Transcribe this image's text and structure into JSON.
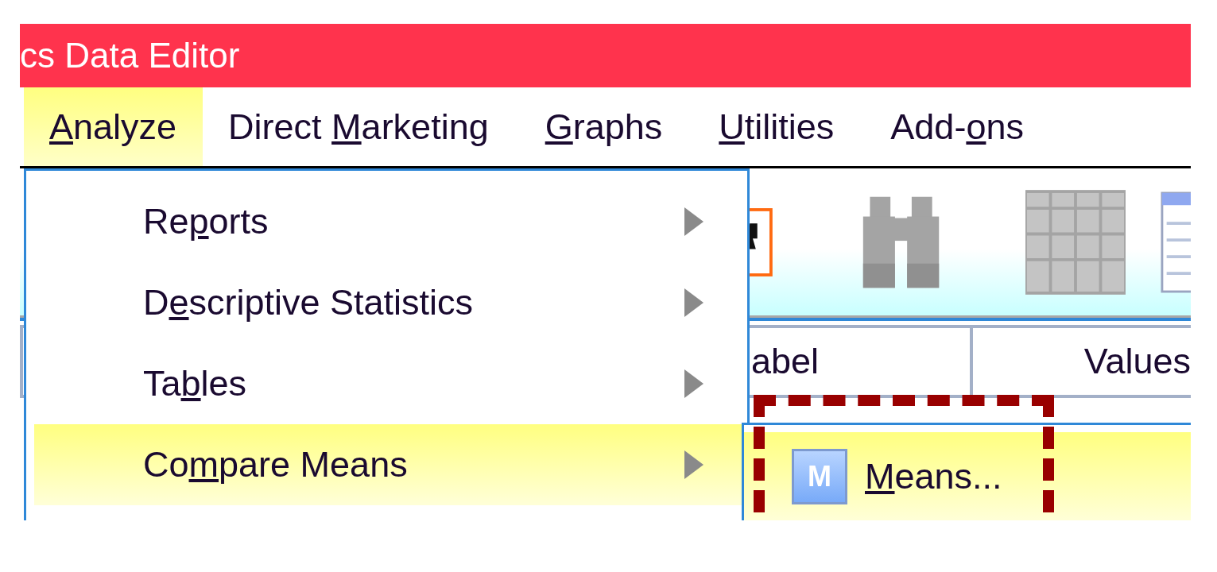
{
  "window": {
    "title": "cs Data Editor"
  },
  "menu_bar": [
    {
      "key": "A",
      "post": "nalyze",
      "selected": true
    },
    {
      "pre": "Direct ",
      "key": "M",
      "post": "arketing",
      "selected": false
    },
    {
      "key": "G",
      "post": "raphs",
      "selected": false
    },
    {
      "key": "U",
      "post": "tilities",
      "selected": false
    },
    {
      "pre": "Add-",
      "key": "o",
      "post": "ns",
      "selected": false
    }
  ],
  "columns": [
    {
      "label": "abel"
    },
    {
      "label": "Values"
    }
  ],
  "analyze_menu": [
    {
      "pre": "Re",
      "key": "p",
      "post": "orts",
      "selected": false,
      "submenu": true
    },
    {
      "pre": "D",
      "key": "e",
      "post": "scriptive Statistics",
      "selected": false,
      "submenu": true
    },
    {
      "pre": "Ta",
      "key": "b",
      "post": "les",
      "selected": false,
      "submenu": true
    },
    {
      "pre": "Co",
      "key": "m",
      "post": "pare Means",
      "selected": true,
      "submenu": true
    }
  ],
  "submenu": [
    {
      "icon_letter": "M",
      "key": "M",
      "post": "eans...",
      "selected": true
    }
  ]
}
